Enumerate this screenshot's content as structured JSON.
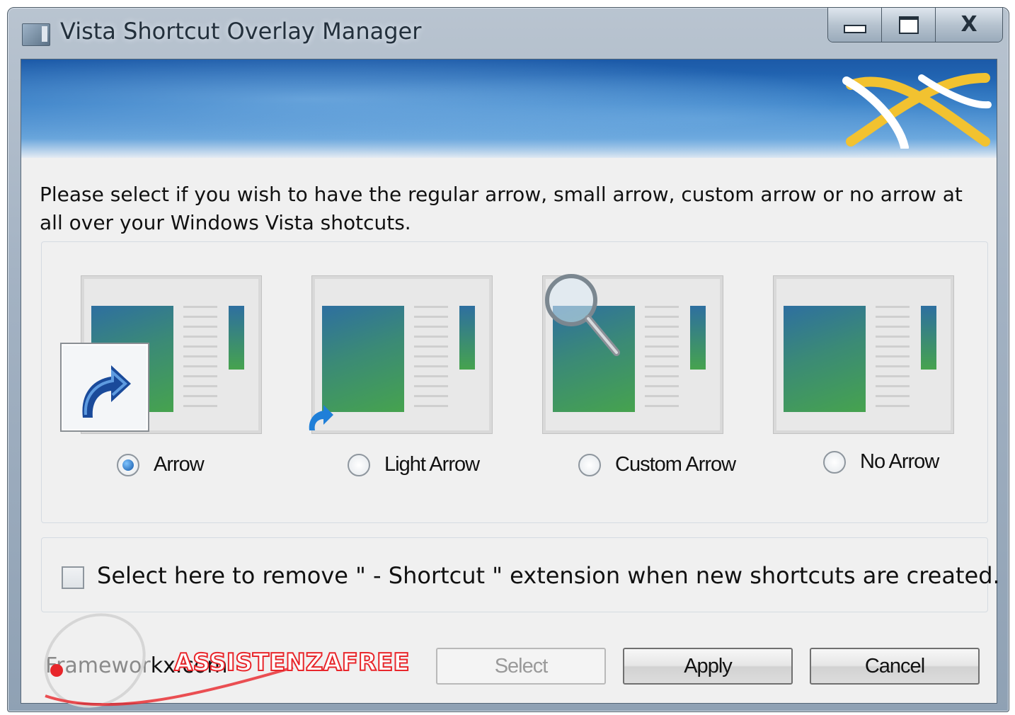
{
  "window": {
    "title": "Vista Shortcut Overlay Manager",
    "caption_buttons": {
      "minimize_icon": "minimize-icon",
      "maximize_icon": "maximize-icon",
      "close_label": "X"
    }
  },
  "main": {
    "instruction": "Please select if you wish to have the regular arrow, small arrow, custom arrow or no arrow at all over your Windows Vista shotcuts.",
    "options": [
      {
        "label": "Arrow",
        "selected": true,
        "preview_icon": "large-shortcut-arrow"
      },
      {
        "label": "Light Arrow",
        "selected": false,
        "preview_icon": "small-shortcut-arrow"
      },
      {
        "label": "Custom Arrow",
        "selected": false,
        "preview_icon": "magnifier"
      },
      {
        "label": "No Arrow",
        "selected": false,
        "preview_icon": "none"
      }
    ],
    "remove_extension": {
      "label": "Select here to remove \" - Shortcut \" extension when new shortcuts are created.",
      "checked": false
    }
  },
  "footer": {
    "link_part1": "Framewor",
    "link_part2": "kx.com",
    "watermark_text": "ASSISTENZAFREE",
    "buttons": {
      "select": "Select",
      "apply": "Apply",
      "cancel": "Cancel"
    }
  },
  "colors": {
    "accent": "#1257a8",
    "banner": "#2a74c0",
    "watermark": "#e8262b"
  }
}
